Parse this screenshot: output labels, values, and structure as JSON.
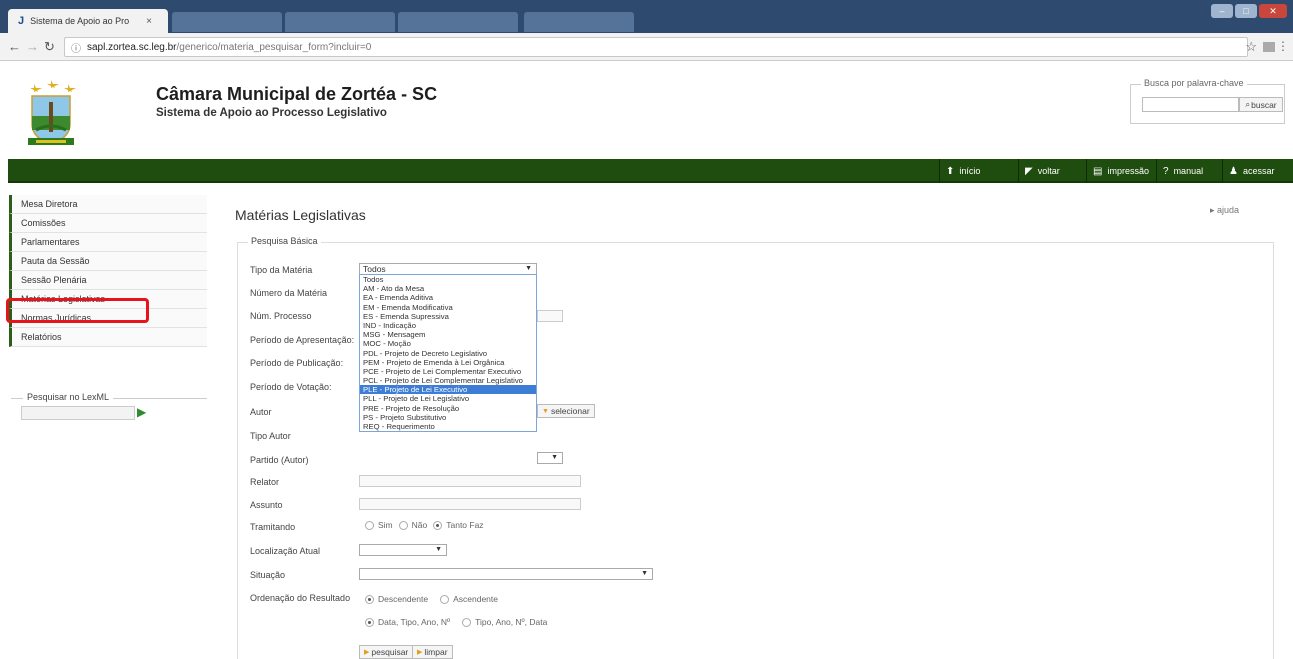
{
  "browser": {
    "tab_title": "Sistema de Apoio ao Pro",
    "tab_close": "×",
    "url_host": "sapl.zortea.sc.leg.br",
    "url_path": "/generico/materia_pesquisar_form?incluir=0"
  },
  "header": {
    "title": "Câmara Municipal de Zortéa - SC",
    "subtitle": "Sistema de Apoio ao Processo Legislativo",
    "search_legend": "Busca por palavra-chave",
    "search_button": "buscar"
  },
  "topnav": [
    {
      "label": "início",
      "icon": "home-icon"
    },
    {
      "label": "voltar",
      "icon": "back-arrow-icon"
    },
    {
      "label": "impressão",
      "icon": "print-icon"
    },
    {
      "label": "manual",
      "icon": "help-icon"
    },
    {
      "label": "acessar",
      "icon": "user-icon"
    }
  ],
  "sidebar": {
    "items": [
      "Mesa Diretora",
      "Comissões",
      "Parlamentares",
      "Pauta da Sessão",
      "Sessão Plenária",
      "Matérias Legislativas",
      "Normas Jurídicas",
      "Relatórios"
    ],
    "lexml_legend": "Pesquisar no LexML"
  },
  "main": {
    "title": "Matérias Legislativas",
    "help": "ajuda",
    "fieldset_legend": "Pesquisa Básica",
    "labels": {
      "tipo_materia": "Tipo da Matéria",
      "numero_materia": "Número da Matéria",
      "num_processo": "Núm. Processo",
      "periodo_apresentacao": "Período de Apresentação:",
      "periodo_publicacao": "Período de Publicação:",
      "periodo_votacao": "Período de Votação:",
      "autor": "Autor",
      "tipo_autor": "Tipo Autor",
      "partido_autor": "Partido (Autor)",
      "relator": "Relator",
      "assunto": "Assunto",
      "tramitando": "Tramitando",
      "localizacao_atual": "Localização Atual",
      "situacao": "Situação",
      "ordenacao": "Ordenação do Resultado"
    },
    "tipo_materia_selected": "Todos",
    "tipo_materia_options": [
      "Todos",
      "AM - Ato da Mesa",
      "EA - Emenda Aditiva",
      "EM - Emenda Modificativa",
      "ES - Emenda Supressiva",
      "IND - Indicação",
      "MSG - Mensagem",
      "MOC - Moção",
      "PDL - Projeto de Decreto Legislativo",
      "PEM - Projeto de Emenda à Lei Orgânica",
      "PCE - Projeto de Lei Complementar Executivo",
      "PCL - Projeto de Lei Complementar Legislativo",
      "PLE - Projeto de Lei Executivo",
      "PLL - Projeto de Lei Legislativo",
      "PRE - Projeto de Resolução",
      "PS - Projeto Substitutivo",
      "REQ - Requerimento"
    ],
    "highlighted_option_index": 12,
    "selecionar_button": "selecionar",
    "tramitando_options": [
      "Sim",
      "Não",
      "Tanto Faz"
    ],
    "tramitando_selected": "Tanto Faz",
    "ordem_options": [
      "Descendente",
      "Ascendente"
    ],
    "ordem_selected": "Descendente",
    "ordem_campos": [
      "Data, Tipo, Ano, Nº",
      "Tipo, Ano, Nº, Data"
    ],
    "ordem_campos_selected": "Data, Tipo, Ano, Nº",
    "pesquisar_button": "pesquisar",
    "limpar_button": "limpar"
  }
}
